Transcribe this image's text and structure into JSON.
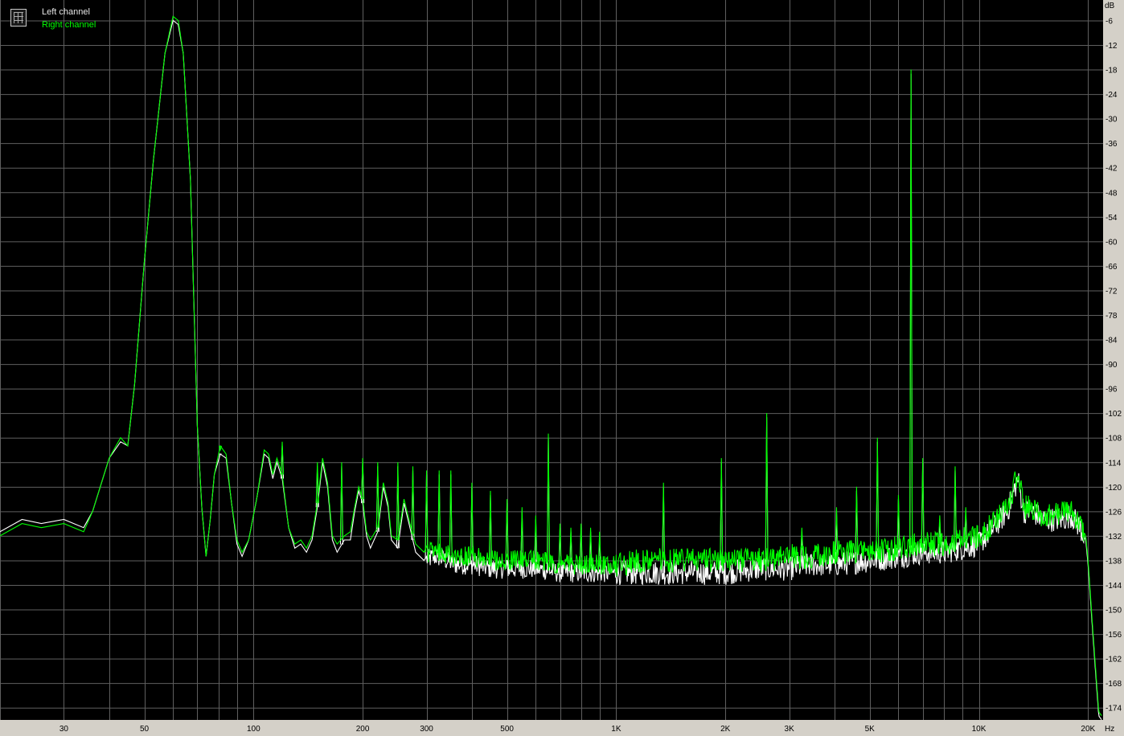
{
  "legend": {
    "left_label": "Left channel",
    "right_label": "Right channel"
  },
  "colors": {
    "background": "#000000",
    "grid": "#5f5f5f",
    "axis_panel": "#d4d0c8",
    "left_channel": "#ffffff",
    "right_channel": "#00ff00"
  },
  "chart_data": {
    "type": "line",
    "title": "",
    "xlabel": "Hz",
    "ylabel": "dB",
    "x_scale": "log",
    "xlim": [
      20,
      22000
    ],
    "ylim": [
      -177,
      -1
    ],
    "grid": true,
    "legend_position": "top-left",
    "x_tick_labels": [
      {
        "value": 30,
        "label": "30"
      },
      {
        "value": 50,
        "label": "50"
      },
      {
        "value": 100,
        "label": "100"
      },
      {
        "value": 200,
        "label": "200"
      },
      {
        "value": 300,
        "label": "300"
      },
      {
        "value": 500,
        "label": "500"
      },
      {
        "value": 1000,
        "label": "1K"
      },
      {
        "value": 2000,
        "label": "2K"
      },
      {
        "value": 3000,
        "label": "3K"
      },
      {
        "value": 5000,
        "label": "5K"
      },
      {
        "value": 10000,
        "label": "10K"
      },
      {
        "value": 20000,
        "label": "20K"
      }
    ],
    "y_ticks": [
      -6,
      -12,
      -18,
      -24,
      -30,
      -36,
      -42,
      -48,
      -54,
      -60,
      -66,
      -72,
      -78,
      -84,
      -90,
      -96,
      -102,
      -108,
      -114,
      -120,
      -126,
      -132,
      -138,
      -144,
      -150,
      -156,
      -162,
      -168,
      -174
    ],
    "series": [
      {
        "name": "Left channel",
        "color": "#ffffff",
        "points": [
          [
            20,
            -131
          ],
          [
            23,
            -128
          ],
          [
            26,
            -129
          ],
          [
            30,
            -128
          ],
          [
            34,
            -130
          ],
          [
            36,
            -126
          ],
          [
            40,
            -113
          ],
          [
            43,
            -109
          ],
          [
            45,
            -110
          ],
          [
            47,
            -95
          ],
          [
            50,
            -65
          ],
          [
            53,
            -40
          ],
          [
            57,
            -14
          ],
          [
            60,
            -6
          ],
          [
            62,
            -7
          ],
          [
            64,
            -14
          ],
          [
            67,
            -45
          ],
          [
            70,
            -105
          ],
          [
            72,
            -125
          ],
          [
            74,
            -137
          ],
          [
            76,
            -128
          ],
          [
            78,
            -117
          ],
          [
            81,
            -112
          ],
          [
            84,
            -113
          ],
          [
            87,
            -124
          ],
          [
            90,
            -134
          ],
          [
            93,
            -137
          ],
          [
            97,
            -133
          ],
          [
            102,
            -123
          ],
          [
            107,
            -112
          ],
          [
            110,
            -113
          ],
          [
            113,
            -118
          ],
          [
            116,
            -114
          ],
          [
            120,
            -118
          ],
          [
            125,
            -130
          ],
          [
            130,
            -135
          ],
          [
            135,
            -134
          ],
          [
            140,
            -136
          ],
          [
            145,
            -133
          ],
          [
            150,
            -125
          ],
          [
            155,
            -114
          ],
          [
            160,
            -120
          ],
          [
            165,
            -133
          ],
          [
            170,
            -136
          ],
          [
            178,
            -133
          ],
          [
            185,
            -133
          ],
          [
            190,
            -126
          ],
          [
            195,
            -121
          ],
          [
            200,
            -124
          ],
          [
            205,
            -132
          ],
          [
            210,
            -135
          ],
          [
            220,
            -131
          ],
          [
            228,
            -120
          ],
          [
            235,
            -125
          ],
          [
            240,
            -133
          ],
          [
            250,
            -135
          ],
          [
            260,
            -124
          ],
          [
            270,
            -130
          ],
          [
            280,
            -136
          ],
          [
            295,
            -138
          ],
          [
            320,
            -137
          ],
          [
            360,
            -139
          ],
          [
            400,
            -139
          ],
          [
            450,
            -140
          ],
          [
            500,
            -140
          ],
          [
            550,
            -140
          ],
          [
            600,
            -140
          ],
          [
            700,
            -141
          ],
          [
            800,
            -141
          ],
          [
            900,
            -141
          ],
          [
            1000,
            -141
          ],
          [
            1200,
            -141
          ],
          [
            1500,
            -141
          ],
          [
            1800,
            -141
          ],
          [
            2000,
            -141
          ],
          [
            2500,
            -140
          ],
          [
            3000,
            -140
          ],
          [
            3500,
            -139
          ],
          [
            4000,
            -139
          ],
          [
            5000,
            -138
          ],
          [
            6000,
            -137
          ],
          [
            7000,
            -136
          ],
          [
            8000,
            -136
          ],
          [
            9000,
            -135
          ],
          [
            10000,
            -134
          ],
          [
            11000,
            -130
          ],
          [
            12000,
            -126
          ],
          [
            12800,
            -118
          ],
          [
            13300,
            -126
          ],
          [
            14000,
            -126
          ],
          [
            15000,
            -128
          ],
          [
            16000,
            -128
          ],
          [
            17000,
            -128
          ],
          [
            18000,
            -127
          ],
          [
            19000,
            -130
          ],
          [
            19700,
            -133
          ],
          [
            20000,
            -139
          ],
          [
            20500,
            -153
          ],
          [
            21000,
            -166
          ],
          [
            21400,
            -176
          ],
          [
            21800,
            -177
          ]
        ]
      },
      {
        "name": "Right channel",
        "color": "#00ff00",
        "points": [
          [
            20,
            -132
          ],
          [
            23,
            -129
          ],
          [
            26,
            -130
          ],
          [
            30,
            -129
          ],
          [
            34,
            -131
          ],
          [
            36,
            -126
          ],
          [
            40,
            -113
          ],
          [
            43,
            -108
          ],
          [
            45,
            -110
          ],
          [
            47,
            -95
          ],
          [
            50,
            -65
          ],
          [
            53,
            -40
          ],
          [
            57,
            -14
          ],
          [
            60,
            -5
          ],
          [
            62,
            -6
          ],
          [
            64,
            -14
          ],
          [
            67,
            -45
          ],
          [
            70,
            -105
          ],
          [
            72,
            -125
          ],
          [
            74,
            -137
          ],
          [
            76,
            -128
          ],
          [
            78,
            -117
          ],
          [
            81,
            -110
          ],
          [
            84,
            -112
          ],
          [
            87,
            -124
          ],
          [
            90,
            -133
          ],
          [
            93,
            -136
          ],
          [
            97,
            -133
          ],
          [
            102,
            -123
          ],
          [
            107,
            -111
          ],
          [
            110,
            -112
          ],
          [
            113,
            -117
          ],
          [
            116,
            -113
          ],
          [
            120,
            -117
          ],
          [
            125,
            -130
          ],
          [
            130,
            -134
          ],
          [
            135,
            -133
          ],
          [
            140,
            -135
          ],
          [
            145,
            -132
          ],
          [
            150,
            -124
          ],
          [
            155,
            -113
          ],
          [
            160,
            -119
          ],
          [
            165,
            -132
          ],
          [
            170,
            -134
          ],
          [
            178,
            -132
          ],
          [
            185,
            -131
          ],
          [
            190,
            -125
          ],
          [
            195,
            -120
          ],
          [
            200,
            -123
          ],
          [
            205,
            -131
          ],
          [
            210,
            -133
          ],
          [
            220,
            -130
          ],
          [
            228,
            -119
          ],
          [
            235,
            -124
          ],
          [
            240,
            -132
          ],
          [
            250,
            -133
          ],
          [
            260,
            -123
          ],
          [
            270,
            -129
          ],
          [
            280,
            -134
          ],
          [
            295,
            -136
          ],
          [
            320,
            -136
          ],
          [
            360,
            -137
          ],
          [
            400,
            -137
          ],
          [
            450,
            -138
          ],
          [
            500,
            -138
          ],
          [
            550,
            -138
          ],
          [
            600,
            -138
          ],
          [
            700,
            -139
          ],
          [
            800,
            -139
          ],
          [
            900,
            -139
          ],
          [
            1000,
            -139
          ],
          [
            1200,
            -138
          ],
          [
            1500,
            -138
          ],
          [
            1800,
            -138
          ],
          [
            2000,
            -138
          ],
          [
            2500,
            -138
          ],
          [
            3000,
            -137
          ],
          [
            3500,
            -137
          ],
          [
            4000,
            -136
          ],
          [
            5000,
            -136
          ],
          [
            6000,
            -135
          ],
          [
            7000,
            -134
          ],
          [
            8000,
            -134
          ],
          [
            9000,
            -133
          ],
          [
            10000,
            -132
          ],
          [
            11000,
            -129
          ],
          [
            12000,
            -125
          ],
          [
            12800,
            -117
          ],
          [
            13300,
            -125
          ],
          [
            14000,
            -125
          ],
          [
            15000,
            -127
          ],
          [
            16000,
            -127
          ],
          [
            17000,
            -126
          ],
          [
            18000,
            -126
          ],
          [
            19000,
            -129
          ],
          [
            19700,
            -132
          ],
          [
            20000,
            -138
          ],
          [
            20500,
            -152
          ],
          [
            21000,
            -165
          ],
          [
            21400,
            -175
          ],
          [
            21800,
            -176
          ]
        ]
      }
    ],
    "spikes": [
      [
        81,
        -111
      ],
      [
        120,
        -109
      ],
      [
        150,
        -114
      ],
      [
        175,
        -114
      ],
      [
        200,
        -113
      ],
      [
        220,
        -114
      ],
      [
        250,
        -114
      ],
      [
        275,
        -115
      ],
      [
        300,
        -116
      ],
      [
        325,
        -116
      ],
      [
        350,
        -116
      ],
      [
        400,
        -119
      ],
      [
        450,
        -121
      ],
      [
        500,
        -123
      ],
      [
        550,
        -125
      ],
      [
        600,
        -127
      ],
      [
        650,
        -107
      ],
      [
        700,
        -129
      ],
      [
        750,
        -130
      ],
      [
        800,
        -129
      ],
      [
        850,
        -130
      ],
      [
        900,
        -131
      ],
      [
        1350,
        -119
      ],
      [
        1950,
        -113
      ],
      [
        2600,
        -102
      ],
      [
        3250,
        -130
      ],
      [
        4050,
        -125
      ],
      [
        4600,
        -120
      ],
      [
        5250,
        -108
      ],
      [
        6000,
        -122
      ],
      [
        6500,
        -18
      ],
      [
        7000,
        -113
      ],
      [
        7800,
        -127
      ],
      [
        8600,
        -115
      ],
      [
        9200,
        -125
      ]
    ]
  }
}
